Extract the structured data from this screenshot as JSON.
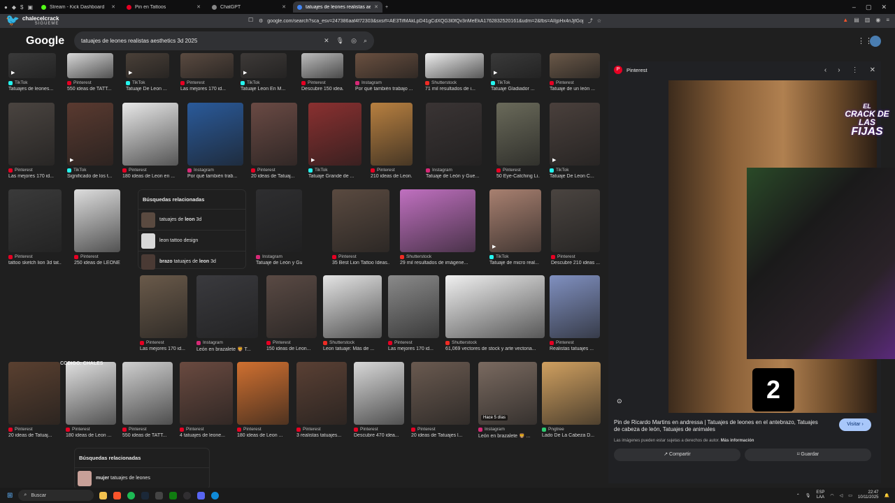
{
  "tabs": [
    {
      "label": "Stream - Kick Dashboard",
      "color": "#53fc18",
      "active": false
    },
    {
      "label": "Pin en Tattoos",
      "color": "#e60023",
      "active": false
    },
    {
      "label": "ChatGPT",
      "color": "#888888",
      "active": false
    },
    {
      "label": "tatuajes de leones realistas aesthe",
      "color": "#4285f4",
      "active": true
    }
  ],
  "browser": {
    "channel_name": "chalecelcrack",
    "channel_sub": "SIGUEME",
    "url": "google.com/search?sca_esv=247386aaf4f72303&sxsrf=AE3TifMAkLpD41gCdXQG3l0fQv3nMeEkA1762832520161&udm=2&fbs=AIIjpHx4nJjfGojPVH..."
  },
  "search": {
    "logo": "Google",
    "query": "tatuajes de leones realistas aesthetics 3d 2025"
  },
  "results": [
    {
      "src": "TikTok",
      "cap": "Tatuajes de leones...",
      "sc": "#25f4ee",
      "bg": "#3a3a3a"
    },
    {
      "src": "Pinterest",
      "cap": "550 ideas de TATT...",
      "sc": "#e60023",
      "bg": "#d8d8d8"
    },
    {
      "src": "TikTok",
      "cap": "Tatuaje De Leon ...",
      "sc": "#25f4ee",
      "bg": "#4a4038"
    },
    {
      "src": "Pinterest",
      "cap": "Las mejores 170 id...",
      "sc": "#e60023",
      "bg": "#5a4a40"
    },
    {
      "src": "TikTok",
      "cap": "Tatuaje Leon En M...",
      "sc": "#25f4ee",
      "bg": "#3e3a38"
    },
    {
      "src": "Pinterest",
      "cap": "Descubre 150 idea...",
      "sc": "#e60023",
      "bg": "#bdbdbd"
    },
    {
      "src": "Instagram",
      "cap": "Por qué también trabajo ...",
      "sc": "#d62976",
      "bg": "#6a5040"
    },
    {
      "src": "Shutterstock",
      "cap": "71 mil resultados de i...",
      "sc": "#ee2b24",
      "bg": "#eeeeee"
    },
    {
      "src": "TikTok",
      "cap": "Tatuaje Gladiador ...",
      "sc": "#25f4ee",
      "bg": "#3a3a3a"
    },
    {
      "src": "Pinterest",
      "cap": "Tatuaje de un león ...",
      "sc": "#e60023",
      "bg": "#6a5848"
    },
    {
      "src": "Pinterest",
      "cap": "Las mejores 170 id...",
      "sc": "#e60023",
      "bg": "#4a4440"
    },
    {
      "src": "TikTok",
      "cap": "Significado de los t...",
      "sc": "#25f4ee",
      "bg": "#5a3a30"
    },
    {
      "src": "Pinterest",
      "cap": "180 ideas de Leon en ...",
      "sc": "#e60023",
      "bg": "#e8e8e8"
    },
    {
      "src": "Instagram",
      "cap": "Por qué también trab...",
      "sc": "#d62976",
      "bg": "#2a5a9a"
    },
    {
      "src": "Pinterest",
      "cap": "20 ideas de Tatuaj...",
      "sc": "#e60023",
      "bg": "#6a4a44"
    },
    {
      "src": "TikTok",
      "cap": "Tatuaje Grande de ...",
      "sc": "#25f4ee",
      "bg": "#8a3030"
    },
    {
      "src": "Pinterest",
      "cap": "210 ideas de Leon...",
      "sc": "#e60023",
      "bg": "#b88040"
    },
    {
      "src": "Instagram",
      "cap": "Tatuaje de León y Gue...",
      "sc": "#d62976",
      "bg": "#3a3434"
    },
    {
      "src": "Pinterest",
      "cap": "50 Eye-Catching Li...",
      "sc": "#e60023",
      "bg": "#6a6a5a"
    },
    {
      "src": "TikTok",
      "cap": "Tatuaje De Leon C...",
      "sc": "#25f4ee",
      "bg": "#4a403c"
    },
    {
      "src": "Pinterest",
      "cap": "tattoo sketch lion 3d tat...",
      "sc": "#e60023",
      "bg": "#3a3a3a"
    },
    {
      "src": "Pinterest",
      "cap": "250 ideas de LEONE...",
      "sc": "#e60023",
      "bg": "#dddddd"
    },
    {
      "src": "Instagram",
      "cap": "Tatuaje de León y Guerrer...",
      "sc": "#d62976",
      "bg": "#2e2e30"
    },
    {
      "src": "Pinterest",
      "cap": "35 Best Lion Tattoo Ideas...",
      "sc": "#e60023",
      "bg": "#5a4a40"
    },
    {
      "src": "Shutterstock",
      "cap": "29 mil resultados de imágene...",
      "sc": "#ee2b24",
      "bg": "#c070c0"
    },
    {
      "src": "TikTok",
      "cap": "Tatuaje de micro real...",
      "sc": "#25f4ee",
      "bg": "#a88070"
    },
    {
      "src": "Pinterest",
      "cap": "Descubre 210 ideas ...",
      "sc": "#e60023",
      "bg": "#4a4440"
    },
    {
      "src": "Pinterest",
      "cap": "Las mejores 170 id...",
      "sc": "#e60023",
      "bg": "#6a5a4a"
    },
    {
      "src": "Instagram",
      "cap": "León en brazalete 🦁 T...",
      "sc": "#d62976",
      "bg": "#3a3a3e"
    },
    {
      "src": "Pinterest",
      "cap": "150 ideas de Leon...",
      "sc": "#e60023",
      "bg": "#5a4a44"
    },
    {
      "src": "Shutterstock",
      "cap": "Leon tatuaje: Más de ...",
      "sc": "#ee2b24",
      "bg": "#e4e4e4"
    },
    {
      "src": "Pinterest",
      "cap": "Las mejores 170 id...",
      "sc": "#e60023",
      "bg": "#8a8a8a"
    },
    {
      "src": "Shutterstock",
      "cap": "61,069 vectores de stock y arte vectoria...",
      "sc": "#ee2b24",
      "bg": "#f0f0f0"
    },
    {
      "src": "Pinterest",
      "cap": "Realistas tatuajes ...",
      "sc": "#e60023",
      "bg": "#8090c0"
    },
    {
      "src": "Pinterest",
      "cap": "20 ideas de Tatuaj...",
      "sc": "#e60023",
      "bg": "#5a4030"
    },
    {
      "src": "Pinterest",
      "cap": "180 ideas de Leon ...",
      "sc": "#e60023",
      "bg": "#e0e0e0"
    },
    {
      "src": "Pinterest",
      "cap": "550 ideas de TATT...",
      "sc": "#e60023",
      "bg": "#cfcfcf"
    },
    {
      "src": "Pinterest",
      "cap": "4 tatuajes de leone...",
      "sc": "#e60023",
      "bg": "#6a4a40"
    },
    {
      "src": "Pinterest",
      "cap": "180 ideas de Leon ...",
      "sc": "#e60023",
      "bg": "#d07030"
    },
    {
      "src": "Pinterest",
      "cap": "3 realistas tatuajes...",
      "sc": "#e60023",
      "bg": "#5a4034"
    },
    {
      "src": "Pinterest",
      "cap": "Descubre 470 idea...",
      "sc": "#e60023",
      "bg": "#d8d8d8"
    },
    {
      "src": "Pinterest",
      "cap": "20 ideas de Tatuajes l...",
      "sc": "#e60023",
      "bg": "#6a5a50"
    },
    {
      "src": "Instagram",
      "cap": "León en brazalete 🦁 ...",
      "sc": "#d62976",
      "bg": "#7a6a60"
    },
    {
      "src": "Pngtree",
      "cap": "Lado De La Cabeza D...",
      "sc": "#2ecc71",
      "bg": "#d0a060"
    }
  ],
  "related1": {
    "heading": "Búsquedas relacionadas",
    "items": [
      {
        "pre": "tatuajes de ",
        "bold": "leon",
        "post": " 3d",
        "bg": "#5a4a40"
      },
      {
        "pre": "leon tattoo design",
        "bold": "",
        "post": "",
        "bg": "#d8d8d8"
      },
      {
        "pre": "",
        "bold": "brazo",
        "post": " tatuajes de ",
        "bold2": "leon",
        "post2": " 3d",
        "bg": "#4a3a34"
      }
    ]
  },
  "related2": {
    "heading": "Búsquedas relacionadas",
    "item": {
      "bold": "mujer",
      "post": " tatuajes de leones",
      "bg": "#c8a098"
    }
  },
  "badge": "Hace 5 días",
  "panel": {
    "source": "Pinterest",
    "title": "Pin de Ricardo Martins en andressa | Tatuajes de leones en el antebrazo, Tatuajes de cabeza de león, Tatuajes de animales",
    "visit": "Visitar ›",
    "note_pre": "Las imágenes pueden estar sujetas a derechos de autor. ",
    "note_link": "Más información",
    "share": "Compartir",
    "save": "Guardar"
  },
  "overlay": {
    "l1": "EL",
    "l2": "CRACK DE LAS",
    "l3": "FIJAS"
  },
  "number_box": "2",
  "watermark": "CODIGO: CHALES",
  "taskbar": {
    "search": "Buscar",
    "lang1": "ESP",
    "lang2": "LAA",
    "time": "22:47",
    "date": "10/11/2025"
  }
}
